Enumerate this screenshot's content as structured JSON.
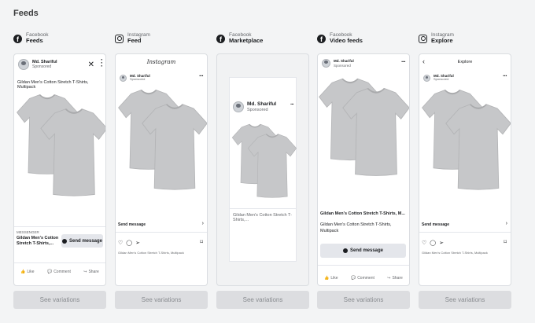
{
  "page": {
    "title": "Feeds"
  },
  "advertiser": {
    "name": "Md. Shariful",
    "sponsored": "Sponsored"
  },
  "product": {
    "title_full": "Gildan Men's Cotton Stretch T-Shirts, Multipack",
    "title_short_fb": "Gildan Men's Cotton Stretch T-Shirts,...",
    "title_mp": "Gildan Men's Cotton Stretch T-Shirts,...",
    "title_video": "Gildan Men's Cotton Stretch T-Shirts, M...",
    "title_video_sub": "Gildan Men's Cotton Stretch T-Shirts, Multipack"
  },
  "labels": {
    "messenger": "MESSENGER",
    "send_message": "Send message",
    "like": "Like",
    "comment": "Comment",
    "share": "Share",
    "see_variations": "See variations",
    "instagram_logo": "Instagram",
    "explore": "Explore"
  },
  "columns": [
    {
      "platform": "Facebook",
      "placement": "Feeds",
      "icon": "facebook-icon"
    },
    {
      "platform": "Instagram",
      "placement": "Feed",
      "icon": "instagram-icon"
    },
    {
      "platform": "Facebook",
      "placement": "Marketplace",
      "icon": "facebook-icon"
    },
    {
      "platform": "Facebook",
      "placement": "Video feeds",
      "icon": "facebook-icon"
    },
    {
      "platform": "Instagram",
      "placement": "Explore",
      "icon": "instagram-icon"
    }
  ],
  "colors": {
    "background": "#f3f4f5",
    "card_border": "#dadde1",
    "button": "#dcdde0",
    "shirt": "#c9cacc"
  }
}
